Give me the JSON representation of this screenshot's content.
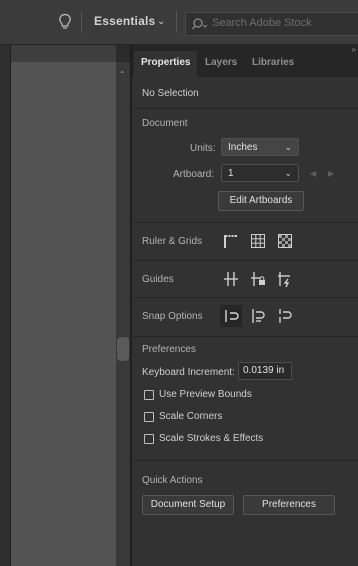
{
  "topbar": {
    "workspace": "Essentials",
    "search_placeholder": "Search Adobe Stock"
  },
  "tabs": [
    {
      "label": "Properties",
      "active": true
    },
    {
      "label": "Layers",
      "active": false
    },
    {
      "label": "Libraries",
      "active": false
    }
  ],
  "properties": {
    "selection": "No Selection",
    "document": {
      "heading": "Document",
      "units_label": "Units:",
      "units_value": "Inches",
      "artboard_label": "Artboard:",
      "artboard_value": "1",
      "edit_artboards": "Edit Artboards"
    },
    "ruler_grids": "Ruler & Grids",
    "guides": "Guides",
    "snap_options": "Snap Options",
    "preferences": {
      "heading": "Preferences",
      "keyboard_label": "Keyboard Increment:",
      "keyboard_value": "0.0139 in",
      "checkboxes": [
        {
          "label": "Use Preview Bounds",
          "checked": false
        },
        {
          "label": "Scale Corners",
          "checked": false
        },
        {
          "label": "Scale Strokes & Effects",
          "checked": false
        }
      ]
    },
    "quick_actions": {
      "heading": "Quick Actions",
      "document_setup": "Document Setup",
      "preferences": "Preferences"
    }
  },
  "colors": {
    "panel": "#323232",
    "tabbar": "#262626",
    "canvas": "#535353",
    "topbar": "#3b3b3b"
  }
}
